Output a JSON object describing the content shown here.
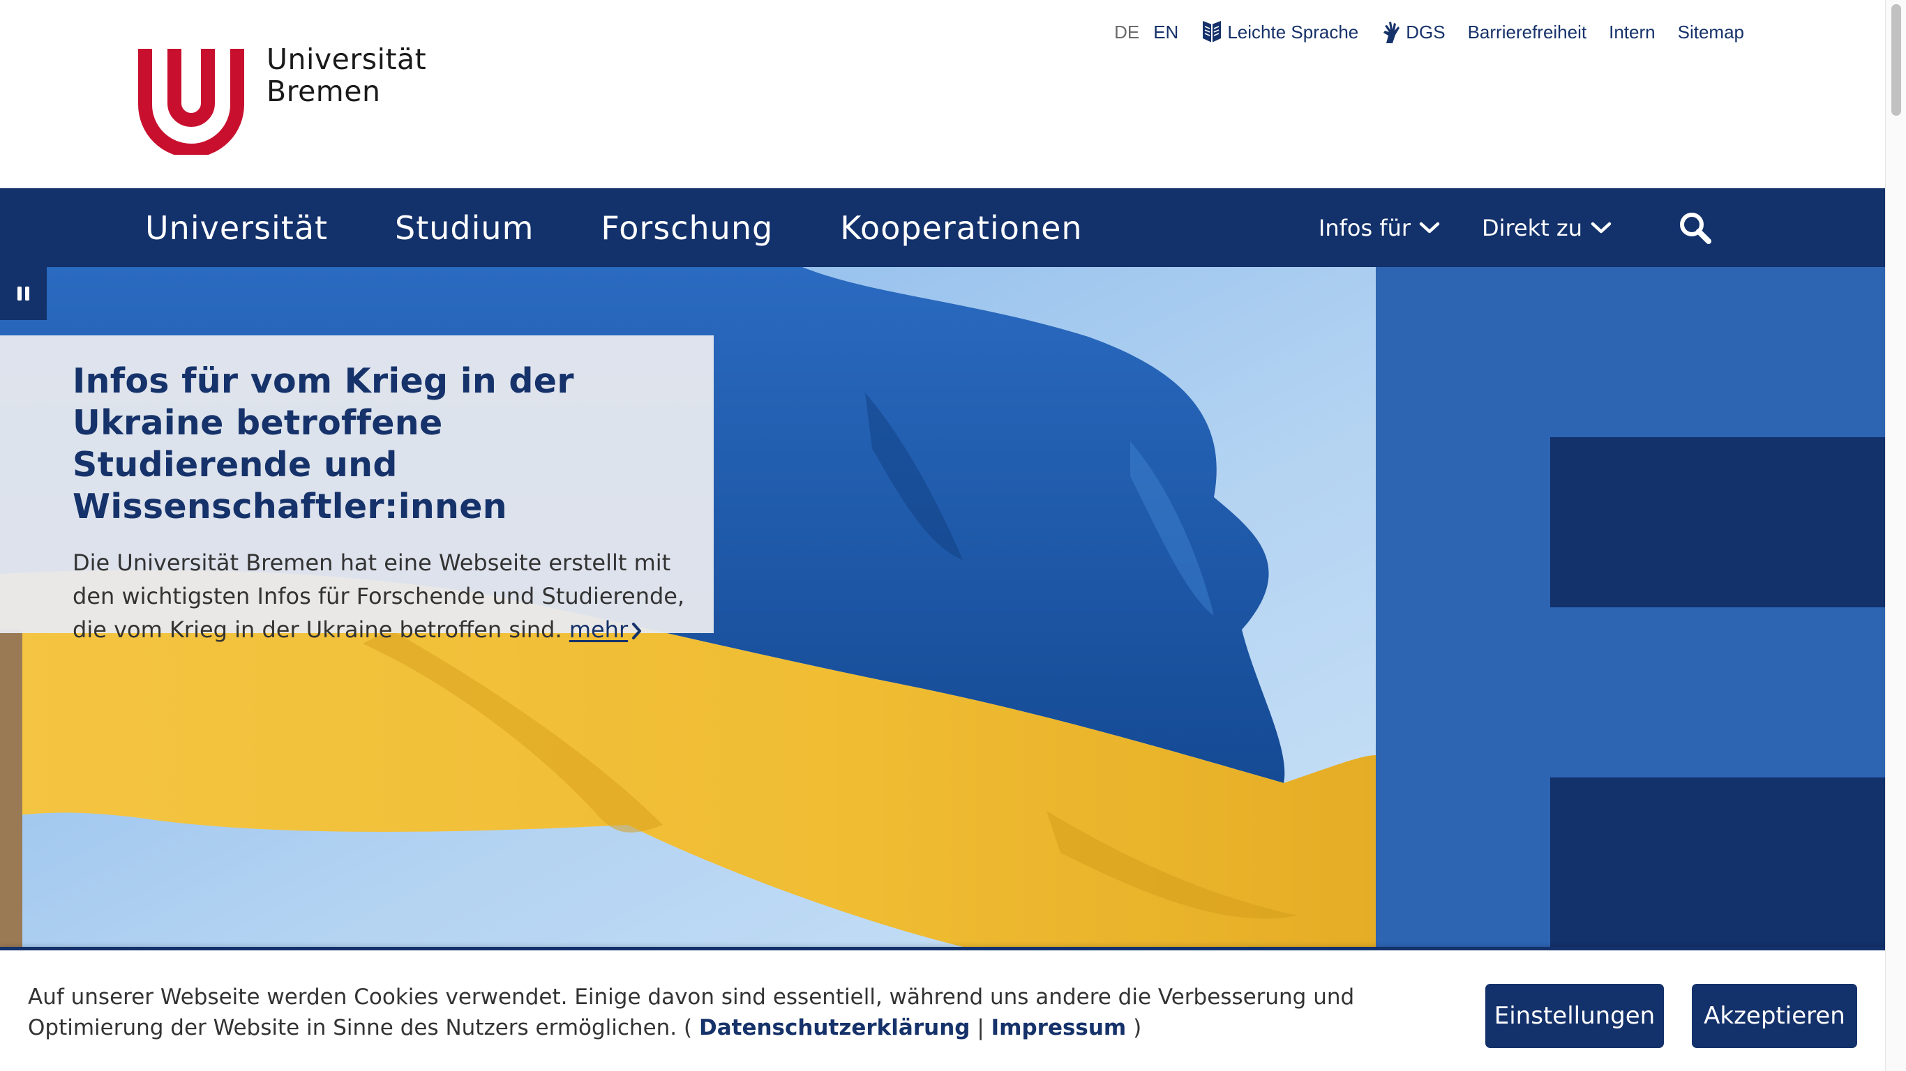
{
  "header": {
    "logo_line1": "Universität",
    "logo_line2": "Bremen",
    "logo_icon": "uni-bremen-u-logo"
  },
  "meta_nav": {
    "lang_de": "DE",
    "lang_en": "EN",
    "easy_language": "Leichte Sprache",
    "easy_language_icon": "book-icon",
    "sign_language": "DGS",
    "sign_language_icon": "hand-sign-icon",
    "accessibility": "Barrierefreiheit",
    "intern": "Intern",
    "sitemap": "Sitemap"
  },
  "main_nav": {
    "items": [
      "Universität",
      "Studium",
      "Forschung",
      "Kooperationen"
    ],
    "infos_fuer": "Infos für",
    "direkt_zu": "Direkt zu",
    "search_icon": "search-icon"
  },
  "hero": {
    "pause_icon": "pause-icon",
    "title": "Infos für vom Krieg in der Ukraine betroffene Studierende und Wissenschaftler:innen",
    "text": "Die Universität Bremen hat eine Webseite erstellt mit den wichtigsten Infos für Forschende und Studierende, die vom Krieg in der Ukraine betroffen sind.",
    "more_link": "mehr"
  },
  "cookie_banner": {
    "text": "Auf unserer Webseite werden Cookies verwendet. Einige davon sind essentiell, während uns andere die Verbesserung und Optimierung der Website in Sinne des Nutzers ermöglichen. (",
    "privacy_link": "Datenschutzerklärung",
    "separator": "|",
    "imprint_link": "Impressum",
    "closing": ")",
    "settings_button": "Einstellungen",
    "accept_button": "Akzeptieren"
  },
  "colors": {
    "navy": "#13316b",
    "link_blue": "#16326a",
    "pattern_blue": "#2d65b3",
    "logo_red": "#c8102e",
    "flag_blue": "#1f5aa8",
    "flag_yellow": "#f2c23a",
    "sky": "#a9cdef"
  }
}
